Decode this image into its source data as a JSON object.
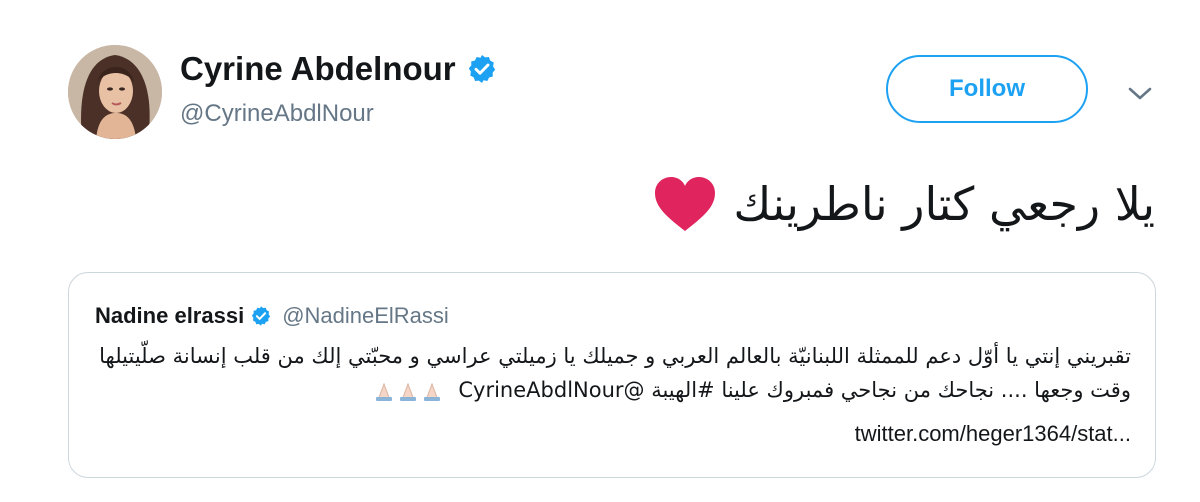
{
  "author": {
    "display_name": "Cyrine Abdelnour",
    "handle": "@CyrineAbdlNour",
    "verified": true,
    "avatar_icon": "profile-photo"
  },
  "actions": {
    "follow_label": "Follow",
    "more_icon": "chevron-down-icon"
  },
  "tweet": {
    "text": "يلا رجعي كتار ناطرينك",
    "emoji": "red-heart"
  },
  "quoted_tweet": {
    "display_name": "Nadine elrassi",
    "handle": "@NadineElRassi",
    "verified": true,
    "text_line1": "تقبريني إنتي يا أوّل دعم للممثلة اللبنانيّة بالعالم العربي و جميلك يا زميلتي عراسي و محبّتي إلك من قلب إنسانة صلّيتيلها",
    "text_line2": "وقت وجعها .... نجاحك من نجاحي فمبروك علينا #الهيبة @CyrineAbdlNour",
    "emoji": "folded-hands x3",
    "link": "twitter.com/heger1364/stat..."
  },
  "colors": {
    "accent": "#1da1f2",
    "secondary_text": "#657786",
    "border": "#ccd6dd",
    "heart": "#e0245e"
  }
}
